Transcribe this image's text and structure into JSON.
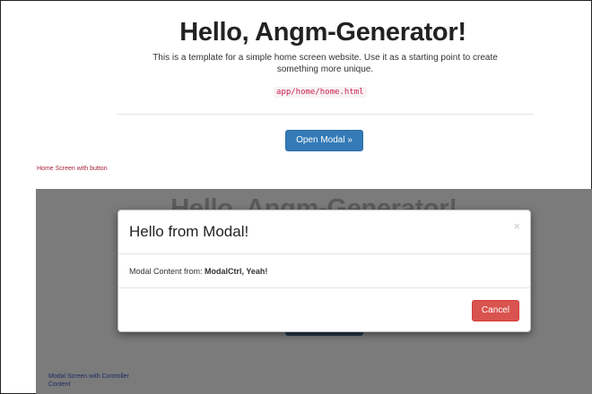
{
  "home": {
    "title": "Hello, Angm-Generator!",
    "description": "This is a template for a simple home screen website. Use it as a starting point to create something more unique.",
    "code_path": "app/home/home.html",
    "open_modal_label": "Open Modal »",
    "caption": "Home Screen with button"
  },
  "backdrop": {
    "ghost_title": "Hello, Angm-Generator!",
    "caption": "Modal Screen with Controller Content"
  },
  "modal": {
    "title": "Hello from Modal!",
    "close_glyph": "×",
    "body_prefix": "Modal Content from: ",
    "body_bold": "ModalCtrl, Yeah!",
    "cancel_label": "Cancel"
  },
  "colors": {
    "primary": "#337ab7",
    "danger": "#d9534f",
    "backdrop": "#7b7b7b",
    "caption_top": "#a4223b",
    "caption_bottom": "#1f2a66"
  }
}
